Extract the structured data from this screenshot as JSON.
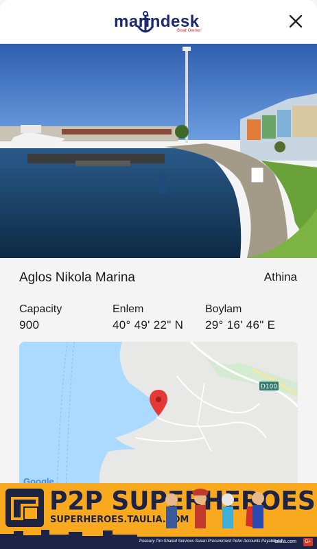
{
  "header": {
    "logo_text": "marindesk",
    "logo_sub": "Boat Owner",
    "close_icon": "close-icon"
  },
  "marina": {
    "name": "Aglos Nikola Marina",
    "city": "Athina",
    "capacity_label": "Capacity",
    "capacity_value": "900",
    "lat_label": "Enlem",
    "lat_value": "40° 49' 22\" N",
    "lon_label": "Boylam",
    "lon_value": "29° 16' 46\" E"
  },
  "map": {
    "road_label": "D100",
    "attribution": "Google",
    "pin_icon": "map-pin-icon"
  },
  "ad": {
    "title": "P2P SUPERHEROES",
    "url": "SUPERHEROES.TAULIA.COM",
    "characters": "Treasury Tim   Shared Services Susan   Procurement Peter   Accounts Payable Ad",
    "brand": "taulia.com"
  },
  "colors": {
    "brand_navy": "#1a2a6e",
    "pin_red": "#e53935",
    "ad_orange": "#f8a91e"
  }
}
